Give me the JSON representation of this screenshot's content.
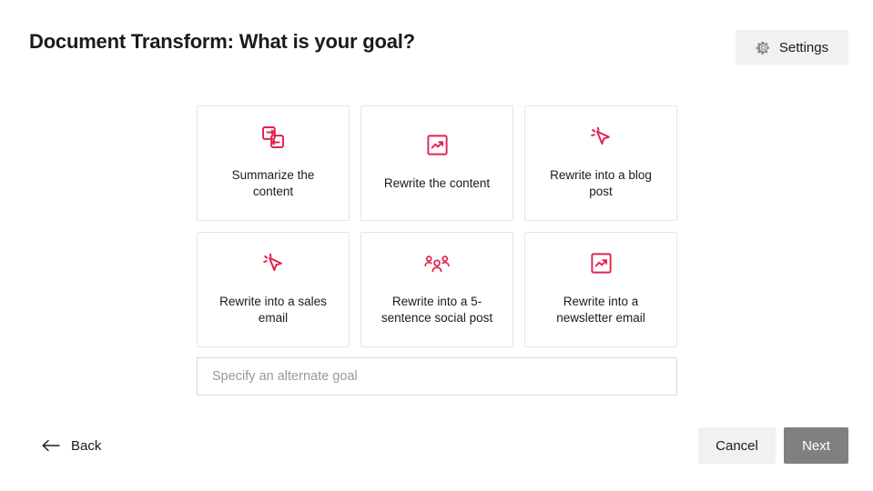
{
  "header": {
    "title": "Document Transform: What is your goal?",
    "settings_label": "Settings",
    "settings_icon": "gear-icon"
  },
  "colors": {
    "accent_red": "#e0244e",
    "card_border": "#e6e6e6",
    "button_gray": "#f1f1f1",
    "next_button_gray": "#808080",
    "text": "#1b1b1b",
    "placeholder": "#9a9a9a",
    "page_background": "#ffffff"
  },
  "goal_cards": [
    {
      "label": "Summarize the content",
      "icon": "exchange-icon"
    },
    {
      "label": "Rewrite the content",
      "icon": "trending-up-icon"
    },
    {
      "label": "Rewrite into a blog post",
      "icon": "cursor-click-icon"
    },
    {
      "label": "Rewrite into a sales email",
      "icon": "cursor-click-icon"
    },
    {
      "label": "Rewrite into a 5-sentence social post",
      "icon": "users-group-icon"
    },
    {
      "label": "Rewrite into a newsletter email",
      "icon": "trending-up-icon"
    }
  ],
  "alternate_goal": {
    "placeholder": "Specify an alternate goal",
    "value": ""
  },
  "footer": {
    "back_label": "Back",
    "back_icon": "arrow-left-icon",
    "cancel_label": "Cancel",
    "next_label": "Next"
  }
}
